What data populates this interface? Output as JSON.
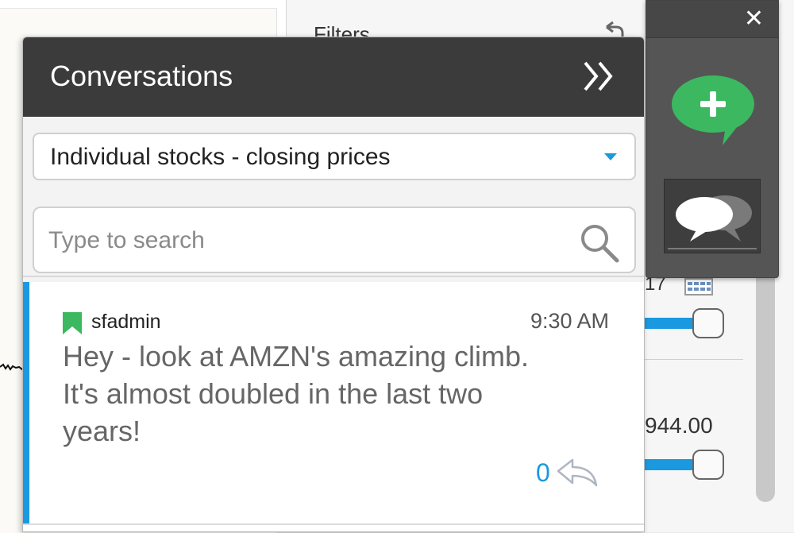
{
  "background": {
    "filters_title": "Filters",
    "date_value": "17",
    "amount_value": "944.00"
  },
  "toolbar": {
    "close_label": "✕",
    "new_conversation_icon": "plus-speech-bubble-icon",
    "conversations_icon": "speech-bubbles-icon"
  },
  "panel": {
    "title": "Conversations",
    "collapse_glyph": "»",
    "filter": {
      "selected": "Individual stocks - closing prices"
    },
    "search": {
      "placeholder": "Type to search",
      "value": ""
    },
    "messages": [
      {
        "author": "sfadmin",
        "time": "9:30 AM",
        "body": "Hey - look at AMZN's amazing climb. It's almost doubled in the last two years!",
        "reply_count": "0"
      }
    ]
  },
  "colors": {
    "accent_blue": "#1a98e0",
    "new_conversation_green": "#3cb860",
    "header_dark": "#3b3b3b",
    "toolbar_gray": "#555555"
  }
}
